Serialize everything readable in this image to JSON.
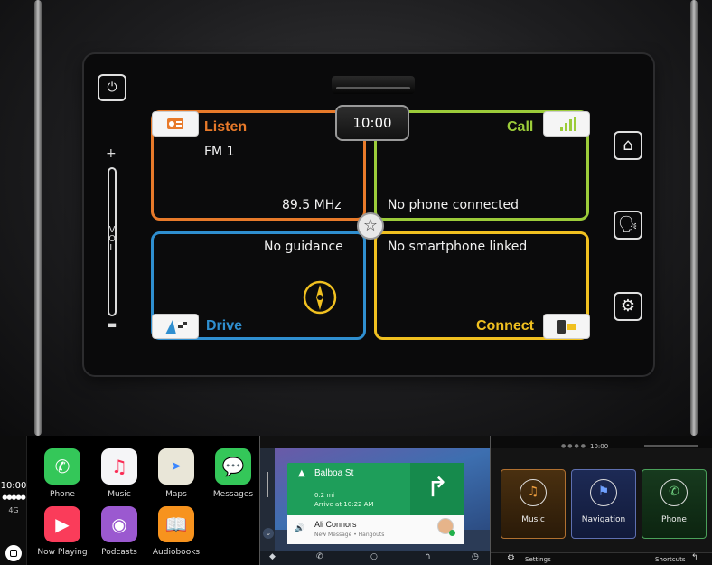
{
  "head_unit": {
    "clock": "10:00",
    "listen": {
      "title": "Listen",
      "source": "FM 1",
      "frequency": "89.5 MHz",
      "color": "#e87a2a"
    },
    "call": {
      "title": "Call",
      "status": "No phone connected",
      "color": "#9ccc3a"
    },
    "drive": {
      "title": "Drive",
      "status": "No guidance",
      "color": "#2f8fd0"
    },
    "connect": {
      "title": "Connect",
      "status": "No smartphone linked",
      "color": "#f0c020"
    },
    "volume_label": "VOL",
    "side_buttons": [
      "home-icon",
      "voice-icon",
      "settings-icon"
    ],
    "top_button": "power-icon"
  },
  "carplay": {
    "time": "10:00",
    "network": "4G",
    "apps": [
      {
        "label": "Phone",
        "icon": "phone-icon",
        "color": "#34c759"
      },
      {
        "label": "Music",
        "icon": "music-icon",
        "color": "#f5f5f7"
      },
      {
        "label": "Maps",
        "icon": "maps-icon",
        "color": "#e9e6d8"
      },
      {
        "label": "Messages",
        "icon": "messages-icon",
        "color": "#34c759"
      },
      {
        "label": "Now Playing",
        "icon": "now-playing-icon",
        "color": "#fa3c5a"
      },
      {
        "label": "Podcasts",
        "icon": "podcasts-icon",
        "color": "#9b59d0"
      },
      {
        "label": "Audiobooks",
        "icon": "audiobooks-icon",
        "color": "#f7931e"
      }
    ]
  },
  "android_auto": {
    "nav_street": "Balboa St",
    "nav_distance": "0.2 mi",
    "nav_eta": "Arrive at 10:22 AM",
    "message_from": "Ali Connors",
    "message_sub": "New Message • Hangouts"
  },
  "oem_panel": {
    "time": "10:00",
    "tiles": [
      {
        "label": "Music",
        "icon": "music-note-icon"
      },
      {
        "label": "Navigation",
        "icon": "flag-icon"
      },
      {
        "label": "Phone",
        "icon": "phone-icon"
      }
    ],
    "settings_label": "Settings",
    "shortcuts_label": "Shortcuts"
  }
}
